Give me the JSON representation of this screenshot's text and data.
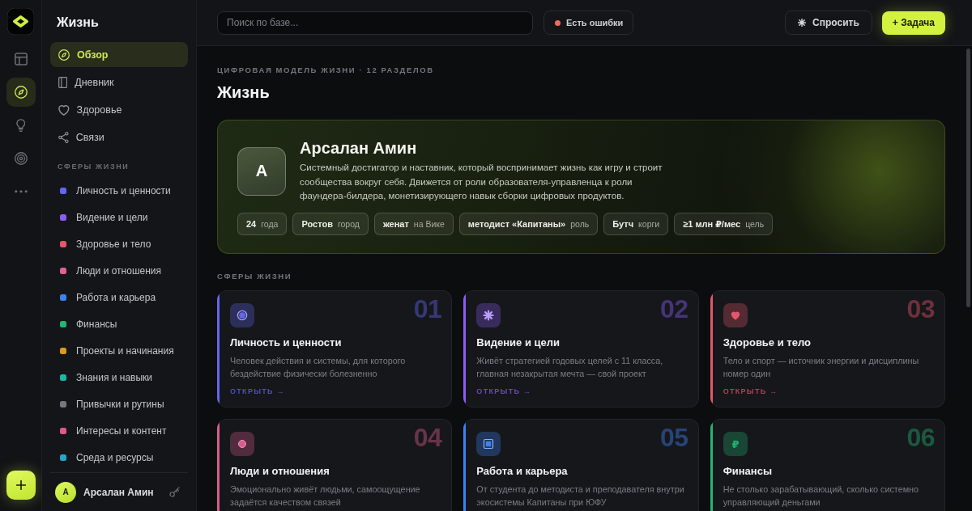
{
  "rail": {
    "items": [
      {
        "kind": "layout",
        "selected": false
      },
      {
        "kind": "compass",
        "selected": true
      },
      {
        "kind": "bulb",
        "selected": false
      },
      {
        "kind": "target",
        "selected": false
      },
      {
        "kind": "more",
        "selected": false
      }
    ]
  },
  "sidebar": {
    "title": "Жизнь",
    "nav": [
      {
        "label": "Обзор",
        "kind": "compass",
        "selected": true
      },
      {
        "label": "Дневник",
        "kind": "book",
        "selected": false
      },
      {
        "label": "Здоровье",
        "kind": "heart",
        "selected": false
      },
      {
        "label": "Связи",
        "kind": "share",
        "selected": false
      }
    ],
    "section_label": "СФЕРЫ ЖИЗНИ",
    "spheres": [
      {
        "label": "Личность и ценности",
        "color": "#6366f1",
        "selected": false
      },
      {
        "label": "Видение и цели",
        "color": "#8b5cf6",
        "selected": false
      },
      {
        "label": "Здоровье и тело",
        "color": "#e5566a",
        "selected": false
      },
      {
        "label": "Люди и отношения",
        "color": "#e0609a",
        "selected": false
      },
      {
        "label": "Работа и карьера",
        "color": "#3b82f6",
        "selected": false
      },
      {
        "label": "Финансы",
        "color": "#22b573",
        "selected": false
      },
      {
        "label": "Проекты и начинания",
        "color": "#d99a1e",
        "selected": false
      },
      {
        "label": "Знания и навыки",
        "color": "#19b8a6",
        "selected": false
      },
      {
        "label": "Привычки и рутины",
        "color": "#75787f",
        "selected": false
      },
      {
        "label": "Интересы и контент",
        "color": "#e2578f",
        "selected": false
      },
      {
        "label": "Среда и ресурсы",
        "color": "#26a5c9",
        "selected": false
      }
    ],
    "user": {
      "initial": "А",
      "name": "Арсалан Амин"
    }
  },
  "topbar": {
    "search": {
      "placeholder": "Поиск по базе..."
    },
    "status": {
      "label": "Есть ошибки"
    },
    "buttons": [
      {
        "label": "Спросить",
        "kind": "ask"
      },
      {
        "label": "+ Задача",
        "kind": "primary"
      }
    ]
  },
  "page": {
    "eyebrow": "ЦИФРОВАЯ МОДЕЛЬ ЖИЗНИ · 12 РАЗДЕЛОВ",
    "title": "Жизнь"
  },
  "profile": {
    "initial": "А",
    "name": "Арсалан Амин",
    "bio": "Системный достигатор и наставник, который воспринимает жизнь как игру и строит сообщества вокруг себя. Движется от роли образователя-управленца к роли фаундера-билдера, монетизирующего навык сборки цифровых продуктов.",
    "facts": [
      {
        "value": "24",
        "label": "года"
      },
      {
        "value": "Ростов",
        "label": "город"
      },
      {
        "value": "женат",
        "label": "на Вике"
      },
      {
        "value": "методист «Капитаны»",
        "label": "роль"
      },
      {
        "value": "Бутч",
        "label": "корги"
      },
      {
        "value": "≥1 млн ₽/мес",
        "label": "цель"
      }
    ]
  },
  "spheres_section": {
    "label": "СФЕРЫ ЖИЗНИ",
    "cards": [
      {
        "number": "01",
        "kind": "ring",
        "color": "#6366f1",
        "title": "Личность и ценности",
        "description": "Человек действия и системы, для которого бездействие физически болезненно",
        "link": "ОТКРЫТЬ →"
      },
      {
        "number": "02",
        "kind": "sparkle",
        "color": "#8b5cf6",
        "title": "Видение и цели",
        "description": "Живёт стратегией годовых целей с 11 класса, главная незакрытая мечта — свой проект",
        "link": "ОТКРЫТЬ →"
      },
      {
        "number": "03",
        "kind": "heart",
        "color": "#e5566a",
        "title": "Здоровье и тело",
        "description": "Тело и спорт — источник энергии и дисциплины номер один",
        "link": "ОТКРЫТЬ →"
      },
      {
        "number": "04",
        "kind": "dot",
        "color": "#db5a8f",
        "title": "Люди и отношения",
        "description": "Эмоционально живёт людьми, самоощущение задаётся качеством связей"
      },
      {
        "number": "05",
        "kind": "square",
        "color": "#3b82f6",
        "title": "Работа и карьера",
        "description": "От студента до методиста и преподавателя внутри экосистемы Капитаны при ЮФУ"
      },
      {
        "number": "06",
        "kind": "glyph",
        "glyph": "₽",
        "color": "#22b573",
        "title": "Финансы",
        "description": "Не столько зарабатывающий, сколько системно управляющий деньгами"
      }
    ]
  }
}
